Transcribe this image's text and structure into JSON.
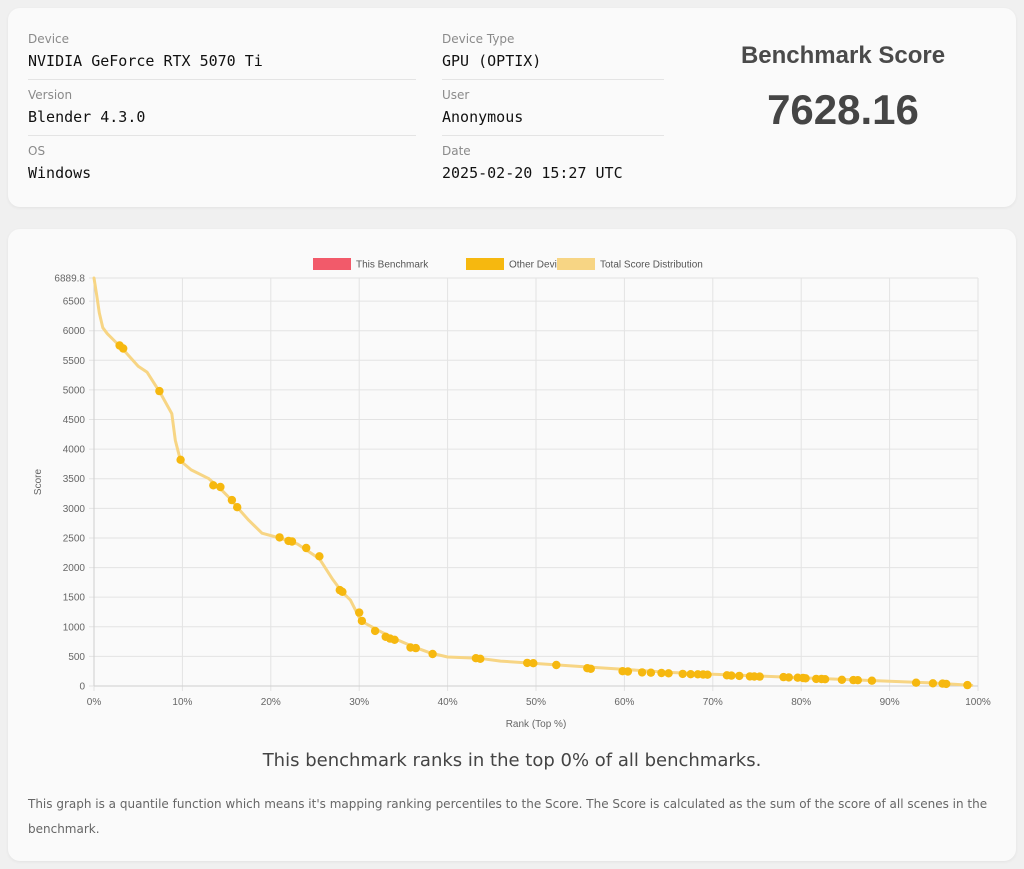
{
  "info": {
    "device_label": "Device",
    "device_value": "NVIDIA GeForce RTX 5070 Ti",
    "version_label": "Version",
    "version_value": "Blender 4.3.0",
    "os_label": "OS",
    "os_value": "Windows",
    "device_type_label": "Device Type",
    "device_type_value": "GPU (OPTIX)",
    "user_label": "User",
    "user_value": "Anonymous",
    "date_label": "Date",
    "date_value": "2025-02-20 15:27 UTC"
  },
  "score": {
    "title": "Benchmark Score",
    "value": "7628.16"
  },
  "summary": {
    "rank_text": "This benchmark ranks in the top 0% of all benchmarks.",
    "description": "This graph is a quantile function which means it's mapping ranking percentiles to the Score. The Score is calculated as the sum of the score of all scenes in the benchmark."
  },
  "colors": {
    "this_benchmark": "#f25a6a",
    "other_devices": "#f6b80f",
    "distribution": "#f7d584"
  },
  "chart_data": {
    "type": "line",
    "xlabel": "Rank (Top %)",
    "ylabel": "Score",
    "xlim": [
      0,
      100
    ],
    "ylim": [
      0,
      6889.8
    ],
    "x_ticks": [
      "0%",
      "10%",
      "20%",
      "30%",
      "40%",
      "50%",
      "60%",
      "70%",
      "80%",
      "90%",
      "100%"
    ],
    "y_ticks": [
      "0",
      "500",
      "1000",
      "1500",
      "2000",
      "2500",
      "3000",
      "3500",
      "4000",
      "4500",
      "5000",
      "5500",
      "6000",
      "6500",
      "6889.8"
    ],
    "grid": true,
    "legend_position": "top",
    "legend": [
      "This Benchmark",
      "Other Devices",
      "Total Score Distribution"
    ],
    "series": [
      {
        "name": "Total Score Distribution",
        "x": [
          0,
          0.3,
          0.6,
          1,
          1.5,
          2.5,
          3.5,
          5,
          6,
          7.5,
          8.8,
          9.2,
          9.8,
          11,
          13,
          14.5,
          15.5,
          16.3,
          17.5,
          19,
          21,
          23,
          25.5,
          27,
          28,
          29,
          30.2,
          32,
          34,
          36,
          38,
          40,
          43.5,
          46,
          50,
          55,
          60,
          65,
          70,
          75,
          80,
          85,
          90,
          95,
          99.3
        ],
        "y": [
          6889.8,
          6600,
          6300,
          6050,
          5950,
          5800,
          5650,
          5400,
          5300,
          4950,
          4600,
          4150,
          3800,
          3650,
          3500,
          3300,
          3150,
          3000,
          2800,
          2580,
          2500,
          2400,
          2150,
          1800,
          1600,
          1450,
          1100,
          950,
          800,
          670,
          560,
          490,
          470,
          420,
          380,
          330,
          280,
          230,
          200,
          170,
          140,
          110,
          80,
          50,
          10
        ]
      },
      {
        "name": "Other Devices",
        "points": [
          [
            2.9,
            5750
          ],
          [
            3.3,
            5700
          ],
          [
            7.4,
            4980
          ],
          [
            9.8,
            3820
          ],
          [
            13.5,
            3390
          ],
          [
            14.3,
            3360
          ],
          [
            15.6,
            3140
          ],
          [
            16.2,
            3020
          ],
          [
            21.0,
            2510
          ],
          [
            22.0,
            2450
          ],
          [
            22.4,
            2440
          ],
          [
            24.0,
            2330
          ],
          [
            25.5,
            2190
          ],
          [
            27.8,
            1620
          ],
          [
            28.1,
            1590
          ],
          [
            30.0,
            1240
          ],
          [
            30.3,
            1100
          ],
          [
            31.8,
            930
          ],
          [
            33.0,
            830
          ],
          [
            33.5,
            800
          ],
          [
            34.0,
            780
          ],
          [
            35.8,
            650
          ],
          [
            36.4,
            640
          ],
          [
            38.3,
            540
          ],
          [
            43.2,
            470
          ],
          [
            43.7,
            460
          ],
          [
            49.0,
            390
          ],
          [
            49.7,
            385
          ],
          [
            52.3,
            355
          ],
          [
            55.8,
            300
          ],
          [
            56.2,
            290
          ],
          [
            59.8,
            250
          ],
          [
            60.4,
            245
          ],
          [
            62.0,
            230
          ],
          [
            63.0,
            225
          ],
          [
            64.2,
            220
          ],
          [
            65.0,
            215
          ],
          [
            66.6,
            205
          ],
          [
            67.5,
            200
          ],
          [
            68.3,
            198
          ],
          [
            68.9,
            195
          ],
          [
            69.4,
            190
          ],
          [
            71.6,
            180
          ],
          [
            72.1,
            175
          ],
          [
            73.0,
            170
          ],
          [
            74.2,
            162
          ],
          [
            74.7,
            160
          ],
          [
            75.3,
            158
          ],
          [
            78.0,
            150
          ],
          [
            78.6,
            145
          ],
          [
            79.6,
            140
          ],
          [
            80.2,
            135
          ],
          [
            80.5,
            130
          ],
          [
            81.7,
            120
          ],
          [
            82.3,
            118
          ],
          [
            82.7,
            115
          ],
          [
            84.6,
            105
          ],
          [
            85.9,
            100
          ],
          [
            86.4,
            98
          ],
          [
            88.0,
            90
          ],
          [
            93.0,
            55
          ],
          [
            94.9,
            45
          ],
          [
            96.0,
            40
          ],
          [
            96.4,
            35
          ],
          [
            98.8,
            15
          ]
        ]
      }
    ]
  }
}
